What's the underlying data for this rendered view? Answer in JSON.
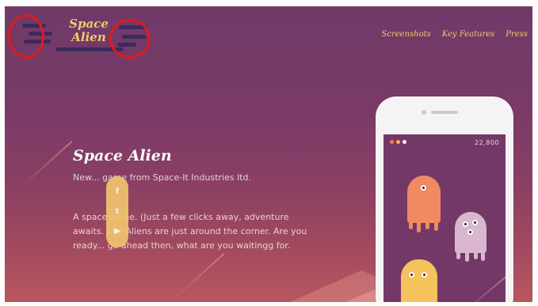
{
  "logo": {
    "line1": "Space",
    "line2": "Alien"
  },
  "nav": {
    "items": [
      "Screenshots",
      "Key Features",
      "Press"
    ]
  },
  "hero": {
    "title": "Space Alien",
    "subtitle": "New... game from Space-It Industries ltd.",
    "description": "A space game. (Just a few clicks away, adventure awaits. The Aliens are just around the corner. Are you ready... go ahead then, what are you waitingg for."
  },
  "social": {
    "icons": [
      "facebook-icon",
      "twitter-icon",
      "youtube-icon"
    ],
    "glyphs": [
      "f",
      "t",
      "▶"
    ]
  },
  "phone": {
    "score": "22,800",
    "dot_colors": [
      "#ff7b5a",
      "#ffb04a",
      "#ffffff"
    ]
  },
  "colors": {
    "accent": "#f3c96a",
    "annotation": "#e01b1b"
  }
}
